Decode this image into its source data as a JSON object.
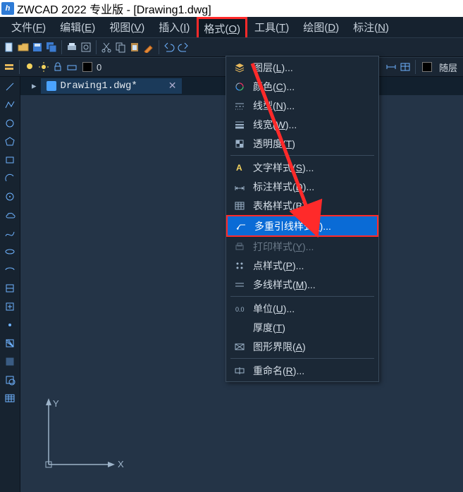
{
  "title": "ZWCAD 2022 专业版 - [Drawing1.dwg]",
  "menu": {
    "file": "文件(F)",
    "edit": "编辑(E)",
    "view": "视图(V)",
    "insert": "插入(I)",
    "format": "格式(O)",
    "tools": "工具(T)",
    "draw": "绘图(D)",
    "dim": "标注(N)"
  },
  "toolbar2": {
    "layer_zero": "0",
    "bylayer_label": "随层"
  },
  "file_tab": {
    "name": "Drawing1.dwg*",
    "close": "✕",
    "arrow": "▸"
  },
  "axes": {
    "x": "X",
    "y": "Y"
  },
  "format_menu": {
    "layer": "图层(L)...",
    "color": "颜色(C)...",
    "linetype": "线型(N)...",
    "lineweight": "线宽(W)...",
    "transparency": "透明度(T)",
    "textstyle": "文字样式(S)...",
    "dimstyle": "标注样式(D)...",
    "tablestyle": "表格样式(B)...",
    "mleaderstyle": "多重引线样式(I)...",
    "plotstyle": "打印样式(Y)...",
    "pointstyle": "点样式(P)...",
    "mlinestyle": "多线样式(M)...",
    "units": "单位(U)...",
    "thickness": "厚度(T)",
    "limits": "图形界限(A)",
    "rename": "重命名(R)..."
  }
}
